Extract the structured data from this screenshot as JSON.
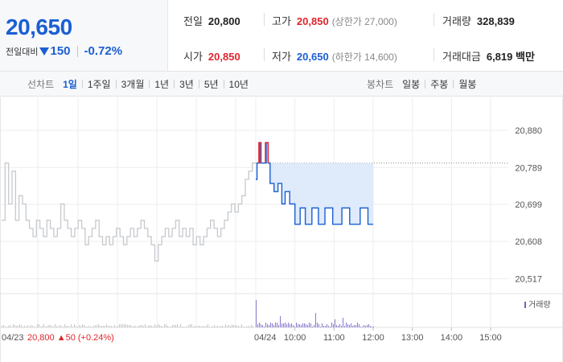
{
  "summary": {
    "price": "20,650",
    "change_label": "전일대비",
    "change_abs": "150",
    "change_pct": "-0.72%",
    "prev": {
      "label": "전일",
      "value": "20,800"
    },
    "open": {
      "label": "시가",
      "value": "20,850"
    },
    "high": {
      "label": "고가",
      "value": "20,850",
      "note": "(상한가 27,000)"
    },
    "low": {
      "label": "저가",
      "value": "20,650",
      "note": "(하한가 14,600)"
    },
    "volume": {
      "label": "거래량",
      "value": "328,839"
    },
    "amount": {
      "label": "거래대금",
      "value": "6,819 백만"
    }
  },
  "toolbar": {
    "line_title": "선차트",
    "line_periods": [
      "1일",
      "1주일",
      "3개월",
      "1년",
      "3년",
      "5년",
      "10년"
    ],
    "active_period": "1일",
    "candle_title": "봉차트",
    "candle_periods": [
      "일봉",
      "주봉",
      "월봉"
    ]
  },
  "colors": {
    "up": "#e0262d",
    "down": "#1a5fd3",
    "prev_day": "#c6c9ce",
    "fill": "#dbe8fb"
  },
  "chart_data": {
    "type": "line",
    "ylim": [
      20500,
      20890
    ],
    "yticks": [
      "20,880",
      "20,789",
      "20,699",
      "20,608",
      "20,517"
    ],
    "ytick_values": [
      20880,
      20789,
      20699,
      20608,
      20517
    ],
    "prev_close_value": 20800,
    "x_ticks": [
      "10:00",
      "11:00",
      "12:00",
      "13:00",
      "14:00",
      "15:00"
    ],
    "x_tick_minutes": [
      540,
      600,
      660,
      720,
      780,
      840
    ],
    "session_start_minute": 480,
    "session_end_minute": 660,
    "date_labels": {
      "prev": "04/23",
      "today": "04/24"
    },
    "prev_day_note": {
      "close": "20,800",
      "arrow": "▲",
      "change": "50",
      "pct": "(+0.24%)"
    },
    "volume_legend": "거래량",
    "prev_day_series": [
      20660,
      20800,
      20700,
      20780,
      20660,
      20720,
      20700,
      20660,
      20640,
      20620,
      20660,
      20640,
      20620,
      20660,
      20640,
      20620,
      20640,
      20700,
      20660,
      20640,
      20620,
      20640,
      20660,
      20640,
      20600,
      20620,
      20640,
      20660,
      20620,
      20600,
      20620,
      20600,
      20620,
      20640,
      20620,
      20600,
      20620,
      20640,
      20620,
      20640,
      20660,
      20640,
      20620,
      20600,
      20560,
      20600,
      20620,
      20640,
      20620,
      20640,
      20660,
      20620,
      20640,
      20620,
      20640,
      20600,
      20620,
      20600,
      20620,
      20640,
      20660,
      20640,
      20620,
      20640,
      20660,
      20680,
      20700,
      20680,
      20700,
      20720,
      20760,
      20780,
      20800
    ],
    "today_series": [
      {
        "m": 480,
        "v": 20760
      },
      {
        "m": 482,
        "v": 20800
      },
      {
        "m": 486,
        "v": 20850
      },
      {
        "m": 488,
        "v": 20800
      },
      {
        "m": 493,
        "v": 20800
      },
      {
        "m": 496,
        "v": 20850
      },
      {
        "m": 499,
        "v": 20800
      },
      {
        "m": 502,
        "v": 20750
      },
      {
        "m": 508,
        "v": 20730
      },
      {
        "m": 514,
        "v": 20750
      },
      {
        "m": 520,
        "v": 20700
      },
      {
        "m": 525,
        "v": 20730
      },
      {
        "m": 532,
        "v": 20700
      },
      {
        "m": 540,
        "v": 20650
      },
      {
        "m": 548,
        "v": 20690
      },
      {
        "m": 556,
        "v": 20650
      },
      {
        "m": 566,
        "v": 20690
      },
      {
        "m": 576,
        "v": 20650
      },
      {
        "m": 586,
        "v": 20690
      },
      {
        "m": 598,
        "v": 20650
      },
      {
        "m": 612,
        "v": 20690
      },
      {
        "m": 624,
        "v": 20650
      },
      {
        "m": 640,
        "v": 20690
      },
      {
        "m": 652,
        "v": 20650
      },
      {
        "m": 660,
        "v": 20650
      }
    ]
  }
}
